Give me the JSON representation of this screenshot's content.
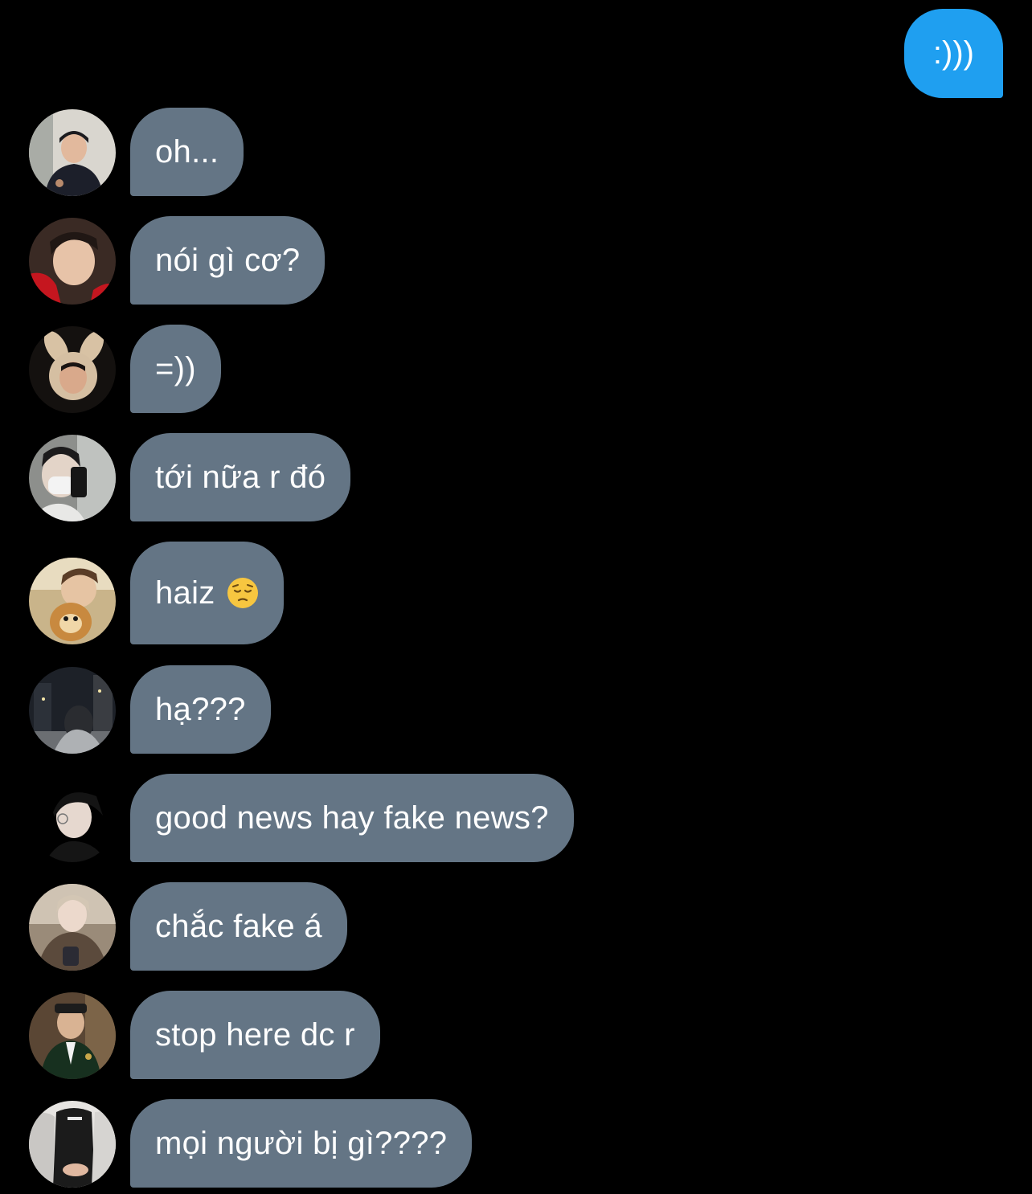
{
  "colors": {
    "background": "#000000",
    "outgoing_bubble": "#1f9ff0",
    "incoming_bubble": "#647585",
    "text": "#ffffff"
  },
  "outgoing_message": {
    "text": ":)))"
  },
  "incoming_messages": [
    {
      "text": "oh...",
      "avatar": "avatar-photo-1"
    },
    {
      "text": "nói gì cơ?",
      "avatar": "avatar-photo-2"
    },
    {
      "text": "=))",
      "avatar": "avatar-photo-3"
    },
    {
      "text": "tới nữa r đó",
      "avatar": "avatar-photo-4"
    },
    {
      "text": "haiz",
      "emoji": "pensive-face-icon",
      "avatar": "avatar-photo-5"
    },
    {
      "text": "hạ???",
      "avatar": "avatar-photo-6"
    },
    {
      "text": "good news hay fake news?",
      "avatar": "avatar-photo-7"
    },
    {
      "text": "chắc fake á",
      "avatar": "avatar-photo-8"
    },
    {
      "text": "stop here dc r",
      "avatar": "avatar-photo-9"
    },
    {
      "text": "mọi người bị gì????",
      "avatar": "avatar-photo-10"
    }
  ]
}
